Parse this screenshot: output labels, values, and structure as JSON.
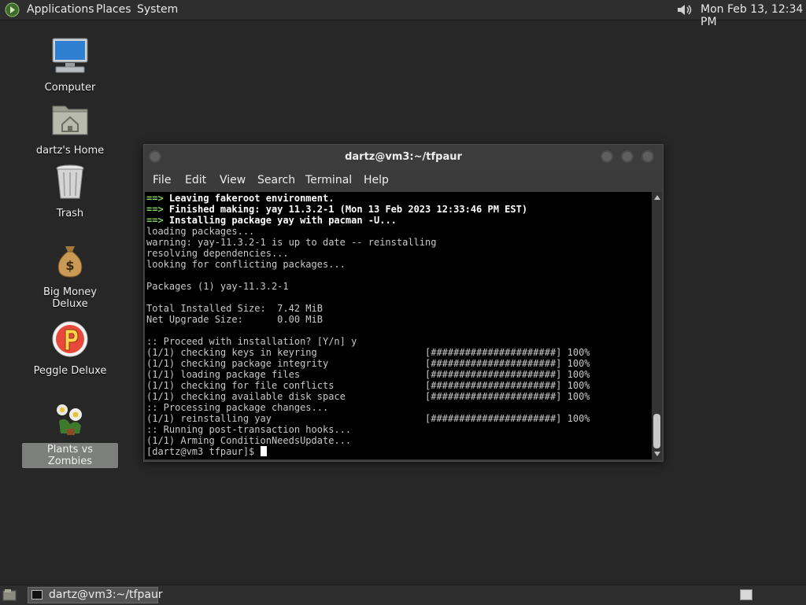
{
  "top_panel": {
    "menus": [
      "Applications",
      "Places",
      "System"
    ],
    "clock": "Mon Feb 13, 12:34 PM"
  },
  "desktop": {
    "icons": [
      {
        "label": "Computer",
        "icon": "computer-icon"
      },
      {
        "label": "dartz's Home",
        "icon": "home-folder-icon"
      },
      {
        "label": "Trash",
        "icon": "trash-icon"
      },
      {
        "label": "Big Money Deluxe",
        "icon": "money-bag-icon"
      },
      {
        "label": "Peggle Deluxe",
        "icon": "peggle-icon"
      },
      {
        "label": "Plants vs Zombies",
        "icon": "plants-vs-zombies-icon",
        "selected": true
      }
    ]
  },
  "terminal": {
    "title": "dartz@vm3:~/tfpaur",
    "menu": [
      "File",
      "Edit",
      "View",
      "Search",
      "Terminal",
      "Help"
    ],
    "lines": [
      {
        "prefix": "==>",
        "text": " Leaving fakeroot environment.",
        "style": "bold"
      },
      {
        "prefix": "==>",
        "text": " Finished making: yay 11.3.2-1 (Mon 13 Feb 2023 12:33:46 PM EST)",
        "style": "bold"
      },
      {
        "prefix": "==>",
        "text": " Installing package yay with pacman -U...",
        "style": "bold"
      },
      {
        "text": "loading packages..."
      },
      {
        "text": "warning: yay-11.3.2-1 is up to date -- reinstalling"
      },
      {
        "text": "resolving dependencies..."
      },
      {
        "text": "looking for conflicting packages..."
      },
      {
        "text": ""
      },
      {
        "text": "Packages (1) yay-11.3.2-1"
      },
      {
        "text": ""
      },
      {
        "text": "Total Installed Size:  7.42 MiB"
      },
      {
        "text": "Net Upgrade Size:      0.00 MiB"
      },
      {
        "text": ""
      },
      {
        "text": ":: Proceed with installation? [Y/n] y"
      },
      {
        "text": "(1/1) checking keys in keyring                   [######################] 100%"
      },
      {
        "text": "(1/1) checking package integrity                 [######################] 100%"
      },
      {
        "text": "(1/1) loading package files                      [######################] 100%"
      },
      {
        "text": "(1/1) checking for file conflicts                [######################] 100%"
      },
      {
        "text": "(1/1) checking available disk space              [######################] 100%"
      },
      {
        "text": ":: Processing package changes..."
      },
      {
        "text": "(1/1) reinstalling yay                           [######################] 100%"
      },
      {
        "text": ":: Running post-transaction hooks..."
      },
      {
        "text": "(1/1) Arming ConditionNeedsUpdate..."
      }
    ],
    "prompt": "[dartz@vm3 tfpaur]$ "
  },
  "taskbar": {
    "task_label": "dartz@vm3:~/tfpaur"
  }
}
